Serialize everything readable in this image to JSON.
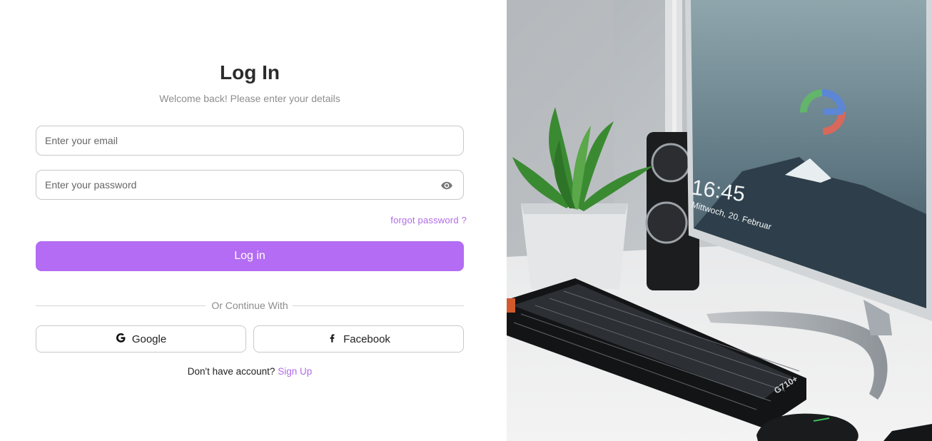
{
  "login": {
    "title": "Log In",
    "subtitle": "Welcome back! Please enter your details",
    "email_placeholder": "Enter your email",
    "password_placeholder": "Enter your password",
    "forgot_password": "forgot password ?",
    "login_button": "Log in",
    "divider_text": "Or Continue With",
    "google_button": "Google",
    "facebook_button": "Facebook",
    "no_account_text": "Don't have account?",
    "signup_link": "Sign Up"
  },
  "hero_image": {
    "clock_time": "16:45",
    "clock_date": "Mittwoch, 20. Februar",
    "keyboard_label": "G710+"
  },
  "colors": {
    "accent": "#b36cf3",
    "link": "#b06be6"
  },
  "icons": {
    "password_toggle": "eye-icon",
    "google": "google-icon",
    "facebook": "facebook-icon"
  }
}
